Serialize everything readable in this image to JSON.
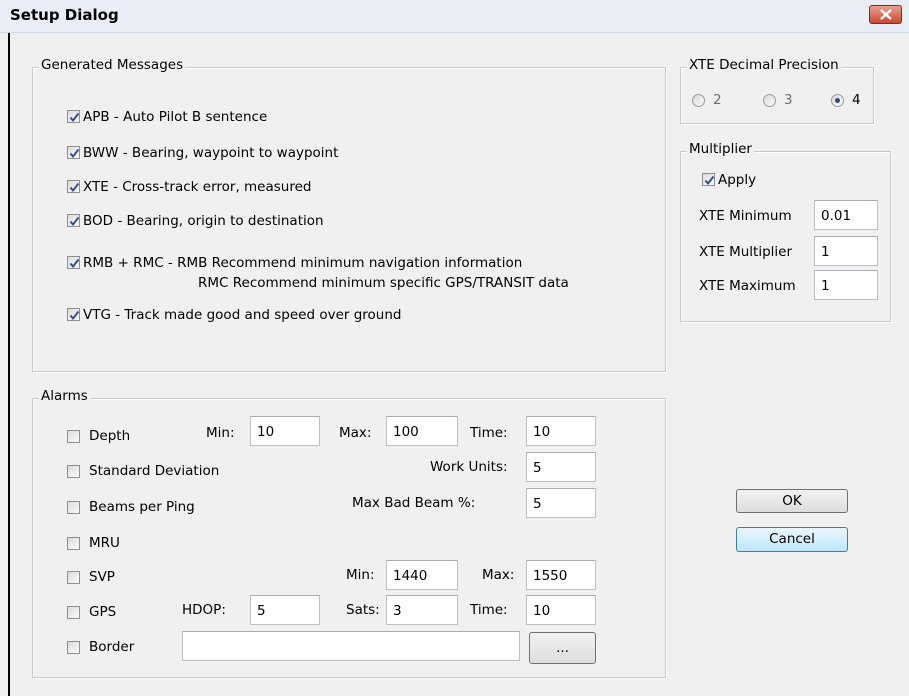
{
  "window": {
    "title": "Setup Dialog"
  },
  "generated_messages": {
    "legend": "Generated Messages",
    "items": [
      {
        "label": "APB -  Auto Pilot B sentence",
        "checked": true
      },
      {
        "label": "BWW - Bearing, waypoint to waypoint",
        "checked": true
      },
      {
        "label": "XTE - Cross-track error, measured",
        "checked": true
      },
      {
        "label": "BOD - Bearing, origin to destination",
        "checked": true
      },
      {
        "label": "RMB + RMC - RMB Recommend minimum navigation information",
        "label2": "RMC Recommend minimum specific GPS/TRANSIT data",
        "checked": true
      },
      {
        "label": "VTG - Track made good and speed over ground",
        "checked": true
      }
    ]
  },
  "xte_precision": {
    "legend": "XTE Decimal Precision",
    "options": [
      "2",
      "3",
      "4"
    ],
    "selected": "4"
  },
  "multiplier": {
    "legend": "Multiplier",
    "apply_label": "Apply",
    "apply_checked": true,
    "min_label": "XTE Minimum",
    "min_value": "0.01",
    "mult_label": "XTE Multiplier",
    "mult_value": "1",
    "max_label": "XTE Maximum",
    "max_value": "1"
  },
  "alarms": {
    "legend": "Alarms",
    "depth": {
      "label": "Depth",
      "min_label": "Min:",
      "min": "10",
      "max_label": "Max:",
      "max": "100",
      "time_label": "Time:",
      "time": "10"
    },
    "std_dev": {
      "label": "Standard Deviation",
      "work_units_label": "Work Units:",
      "work_units": "5"
    },
    "beams": {
      "label": "Beams per Ping",
      "max_bad_label": "Max Bad Beam %:",
      "max_bad": "5"
    },
    "mru": {
      "label": "MRU"
    },
    "svp": {
      "label": "SVP",
      "min_label": "Min:",
      "min": "1440",
      "max_label": "Max:",
      "max": "1550"
    },
    "gps": {
      "label": "GPS",
      "hdop_label": "HDOP:",
      "hdop": "5",
      "sats_label": "Sats:",
      "sats": "3",
      "time_label": "Time:",
      "time": "10"
    },
    "border": {
      "label": "Border",
      "path": "",
      "browse_label": "..."
    }
  },
  "buttons": {
    "ok": "OK",
    "cancel": "Cancel"
  },
  "icons": {
    "close": "close-icon",
    "check": "checkmark-icon"
  },
  "colors": {
    "check": "#2b4e8a",
    "close_red": "#c94a31",
    "default_button": "#3c7fb1"
  }
}
